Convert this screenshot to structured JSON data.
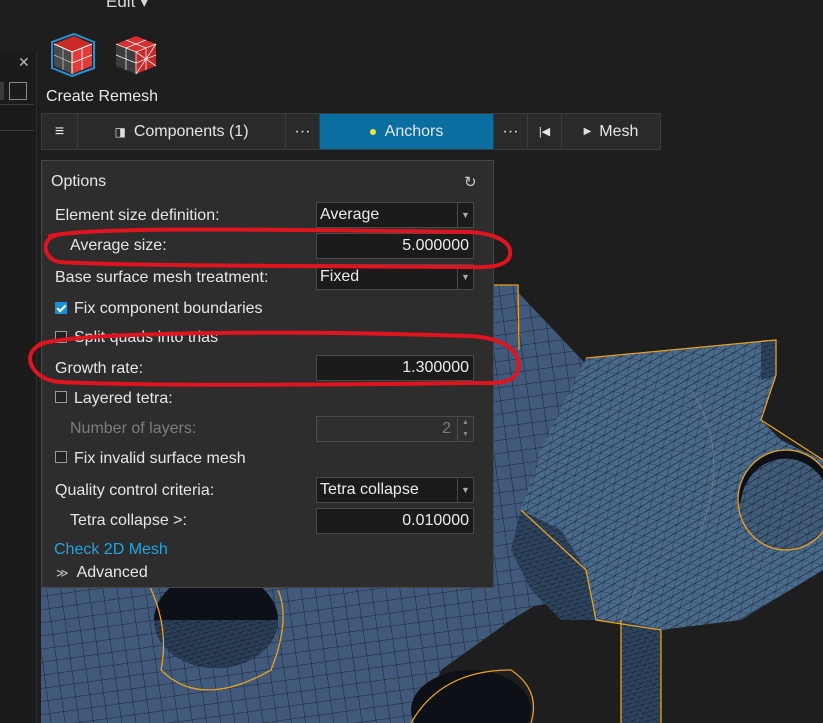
{
  "menu": {
    "edit_label": "Edit ▾"
  },
  "tools": {
    "remesh_icon": "remesh-cube-icon",
    "remesh_alt_icon": "remesh-cube-red-icon",
    "create_label": "Create Remesh"
  },
  "tabs": {
    "menu_glyph": "≡",
    "components_label": "Components (1)",
    "more_glyph": "···",
    "anchors_label": "Anchors",
    "back_glyph": "|◀",
    "mesh_label": "Mesh",
    "active": "Anchors"
  },
  "options": {
    "title": "Options",
    "reset_glyph": "↻",
    "element_size_def_label": "Element size definition:",
    "element_size_def_value": "Average",
    "average_size_label": "Average size:",
    "average_size_value": "5.000000",
    "base_surface_label": "Base surface mesh treatment:",
    "base_surface_value": "Fixed",
    "fix_boundaries_label": "Fix component boundaries",
    "fix_boundaries_checked": true,
    "split_quads_label": "Split quads into trias",
    "split_quads_checked": false,
    "growth_rate_label": "Growth rate:",
    "growth_rate_value": "1.300000",
    "layered_tetra_label": "Layered tetra:",
    "layered_tetra_checked": false,
    "num_layers_label": "Number of layers:",
    "num_layers_value": "2",
    "fix_invalid_label": "Fix invalid surface mesh",
    "fix_invalid_checked": false,
    "quality_label": "Quality control criteria:",
    "quality_value": "Tetra collapse",
    "tetra_collapse_label": "Tetra collapse >:",
    "tetra_collapse_value": "0.010000",
    "check_link": "Check 2D Mesh",
    "advanced_label": "Advanced"
  },
  "colors": {
    "accent": "#0a6fa0",
    "annotation": "#e0141e",
    "mesh_fill": "#3f5a7c",
    "mesh_edge": "#e8a020"
  }
}
